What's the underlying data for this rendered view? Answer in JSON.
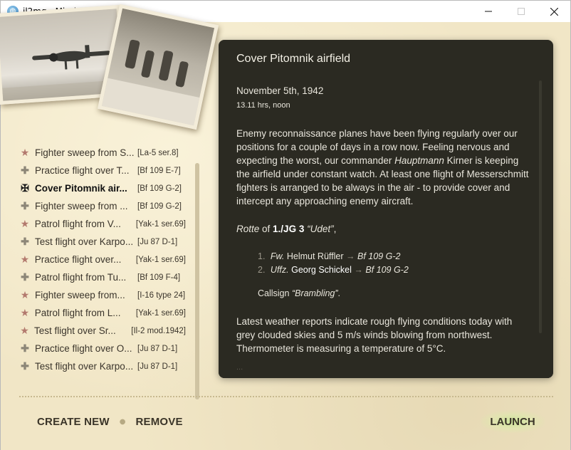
{
  "window": {
    "title": "il2mg - Mission Generator",
    "app_icon": "globe-icon",
    "controls": [
      "minimize-icon",
      "maximize-icon",
      "close-icon"
    ]
  },
  "missions": [
    {
      "icon": "star",
      "name": "Fighter sweep from S...",
      "plane": "[La-5 ser.8]"
    },
    {
      "icon": "cross",
      "name": "Practice flight over T...",
      "plane": "[Bf 109 E-7]"
    },
    {
      "icon": "balkenkreuz",
      "name": "Cover Pitomnik air...",
      "plane": "[Bf 109 G-2]",
      "selected": true
    },
    {
      "icon": "cross",
      "name": "Fighter sweep from ...",
      "plane": "[Bf 109 G-2]"
    },
    {
      "icon": "star",
      "name": "Patrol flight from V...",
      "plane": "[Yak-1 ser.69]"
    },
    {
      "icon": "cross",
      "name": "Test flight over Karpo...",
      "plane": "[Ju 87 D-1]"
    },
    {
      "icon": "star",
      "name": "Practice flight over...",
      "plane": "[Yak-1 ser.69]"
    },
    {
      "icon": "cross",
      "name": "Patrol flight from Tu...",
      "plane": "[Bf 109 F-4]"
    },
    {
      "icon": "star",
      "name": "Fighter sweep from...",
      "plane": "[I-16 type 24]"
    },
    {
      "icon": "star",
      "name": "Patrol flight from L...",
      "plane": "[Yak-1 ser.69]"
    },
    {
      "icon": "star",
      "name": "Test flight over Sr...",
      "plane": "[Il-2 mod.1942]"
    },
    {
      "icon": "cross",
      "name": "Practice flight over O...",
      "plane": "[Ju 87 D-1]"
    },
    {
      "icon": "cross",
      "name": "Test flight over Karpo...",
      "plane": "[Ju 87 D-1]"
    }
  ],
  "briefing": {
    "title": "Cover Pitomnik airfield",
    "date": "November 5th, 1942",
    "time": "13.11 hrs, noon",
    "para1_a": "Enemy reconnaissance planes have been flying regularly over our positions for a couple of days in a row now. Feeling nervous and expecting the worst, our commander ",
    "para1_rank": "Hauptmann",
    "para1_b": " Kirner is keeping the airfield under constant watch. At least one flight of Messerschmitt fighters is arranged to be always in the air - to provide cover and intercept any approaching enemy aircraft.",
    "unit_type": "Rotte",
    "unit_of": " of ",
    "unit_name": "1./JG 3",
    "unit_nick": "“Udet”",
    "unit_end": ",",
    "crew": [
      {
        "num": "1.",
        "rank": "Fw.",
        "name": "Helmut Rüffler",
        "aircraft": "Bf 109 G-2"
      },
      {
        "num": "2.",
        "rank": "Uffz.",
        "name": "Georg Schickel",
        "aircraft": "Bf 109 G-2"
      }
    ],
    "callsign_label": "Callsign ",
    "callsign_value": "“Brambling”",
    "callsign_end": ".",
    "weather": "Latest weather reports indicate rough flying conditions today with grey clouded skies and 5 m/s winds blowing from northwest. Thermometer is measuring a temperature of 5°C.",
    "more": "..."
  },
  "actions": {
    "create_new": "CREATE NEW",
    "remove": "REMOVE",
    "launch": "LAUNCH"
  }
}
